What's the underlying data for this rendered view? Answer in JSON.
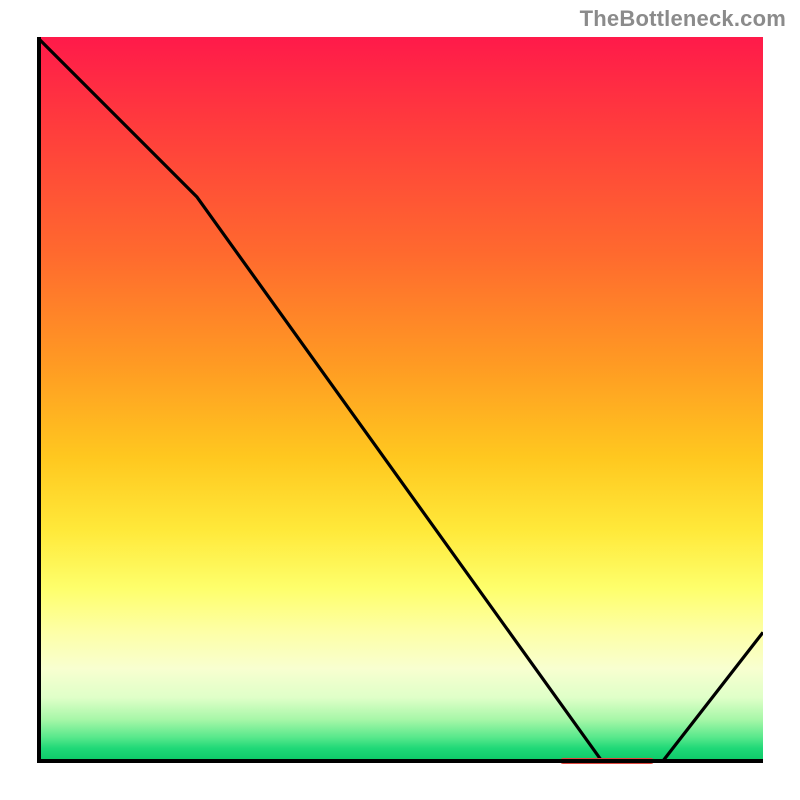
{
  "watermark": "TheBottleneck.com",
  "colors": {
    "gradient_top": "#ff1a4a",
    "gradient_mid": "#ffe93a",
    "gradient_bottom": "#09c765",
    "axis": "#000000",
    "curve": "#000000",
    "marker": "#e0483f",
    "watermark_text": "#8b8b8b"
  },
  "chart_data": {
    "type": "line",
    "title": "",
    "xlabel": "",
    "ylabel": "",
    "xlim": [
      0,
      100
    ],
    "ylim": [
      0,
      100
    ],
    "x": [
      0,
      22,
      78,
      86,
      100
    ],
    "y": [
      100,
      78,
      0,
      0,
      18
    ],
    "marker": {
      "x_start": 72,
      "x_end": 85,
      "y": 0
    },
    "annotations": []
  }
}
